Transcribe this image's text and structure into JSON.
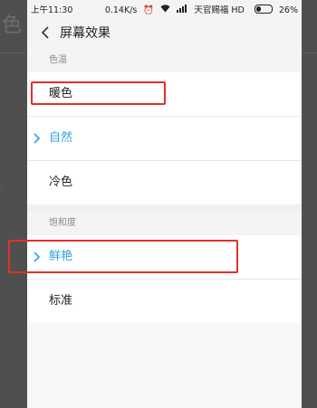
{
  "background_app": {
    "title_fragment": "色",
    "side_mark": "·"
  },
  "statusbar": {
    "time": "上午11:30",
    "speed": "0.14K/s",
    "carrier": "天官赐福 HD",
    "battery_percent": "26%"
  },
  "header": {
    "title": "屏幕效果"
  },
  "sections": [
    {
      "title": "色温",
      "items": [
        {
          "label": "暖色",
          "selected": false
        },
        {
          "label": "自然",
          "selected": true
        },
        {
          "label": "冷色",
          "selected": false
        }
      ]
    },
    {
      "title": "饱和度",
      "items": [
        {
          "label": "鲜艳",
          "selected": true
        },
        {
          "label": "标准",
          "selected": false
        }
      ]
    }
  ],
  "colors": {
    "accent": "#2aa3ea",
    "annotation": "#e0302b"
  }
}
